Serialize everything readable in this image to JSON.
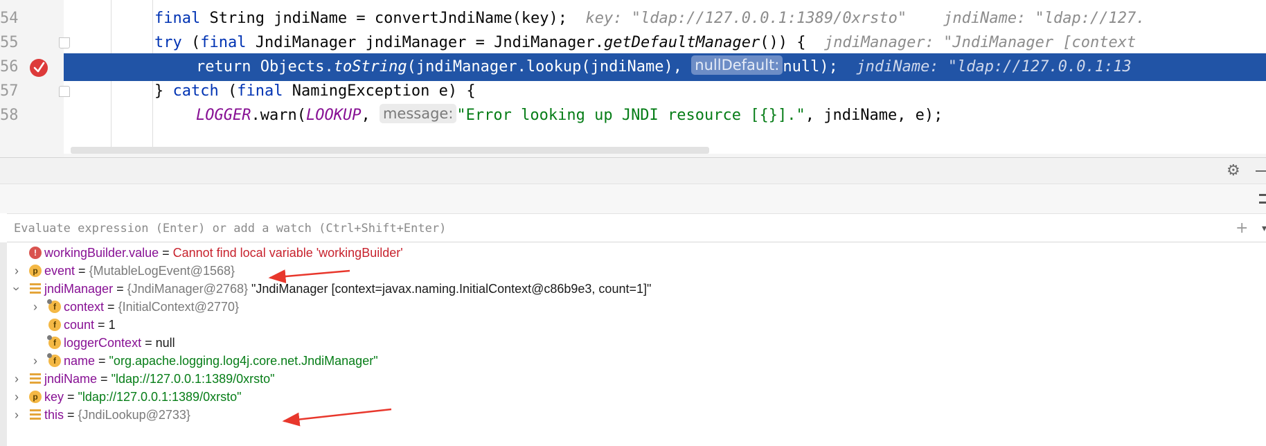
{
  "editor": {
    "lines": [
      {
        "number": "54",
        "code_a": "final",
        "code_b": " String jndiName = convertJndiName(key);",
        "inline_values": "  key: \"ldap://127.0.0.1:1389/0xrsto\"    jndiName: \"ldap://127."
      },
      {
        "number": "55",
        "code_a": "try",
        "code_b": " (",
        "code_c": "final",
        "code_d": " JndiManager jndiManager = JndiManager.",
        "code_e": "getDefaultManager",
        "code_f": "()) {",
        "inline_values": "  jndiManager: \"JndiManager [context"
      },
      {
        "number": "56",
        "code_a": "return",
        "code_b": " Objects.",
        "code_c": "toString",
        "code_d": "(jndiManager.lookup(jndiName), ",
        "hint": "nullDefault:",
        "code_e": "null);",
        "inline_values": "  jndiName: \"ldap://127.0.0.1:13"
      },
      {
        "number": "57",
        "code_a": "} ",
        "code_b": "catch",
        "code_c": " (",
        "code_d": "final",
        "code_e": " NamingException e) {"
      },
      {
        "number": "58",
        "code_a": "LOGGER",
        "code_b": ".warn(",
        "code_c": "LOOKUP",
        "code_d": ", ",
        "hint": "message:",
        "code_e": "\"Error looking up JNDI resource [{}].\"",
        "code_f": ", jndiName, e);"
      }
    ]
  },
  "panel": {
    "eval_placeholder": "Evaluate expression (Enter) or add a watch (Ctrl+Shift+Enter)",
    "eval_value": "",
    "icons": {
      "gear": "⚙",
      "add": "+",
      "dropdown": "▾"
    }
  },
  "variables": [
    {
      "icon": "!",
      "name": "workingBuilder.value",
      "eq": " = ",
      "value": "Cannot find local variable 'workingBuilder'",
      "value_kind": "error"
    },
    {
      "icon": "p",
      "name": "event",
      "eq": " = ",
      "value": "{MutableLogEvent@1568}",
      "value_kind": "type"
    },
    {
      "icon": "lines",
      "name": "jndiManager",
      "eq": " = ",
      "value": "{JndiManager@2768}",
      "value_kind": "type",
      "extra": " \"JndiManager [context=javax.naming.InitialContext@c86b9e3, count=1]\""
    },
    {
      "icon": "f",
      "name": "context",
      "eq": " = ",
      "value": "{InitialContext@2770}",
      "value_kind": "type"
    },
    {
      "icon": "f",
      "name": "count",
      "eq": " = ",
      "value": "1",
      "value_kind": "plain"
    },
    {
      "icon": "f",
      "name": "loggerContext",
      "eq": " = ",
      "value": "null",
      "value_kind": "plain"
    },
    {
      "icon": "f",
      "name": "name",
      "eq": " = ",
      "value": "\"org.apache.logging.log4j.core.net.JndiManager\"",
      "value_kind": "string"
    },
    {
      "icon": "lines",
      "name": "jndiName",
      "eq": " = ",
      "value": "\"ldap://127.0.0.1:1389/0xrsto\"",
      "value_kind": "string"
    },
    {
      "icon": "p",
      "name": "key",
      "eq": " = ",
      "value": "\"ldap://127.0.0.1:1389/0xrsto\"",
      "value_kind": "string"
    },
    {
      "icon": "lines",
      "name": "this",
      "eq": " = ",
      "value": "{JndiLookup@2733}",
      "value_kind": "type"
    }
  ],
  "colors": {
    "current_line": "#2154a6",
    "keyword": "#0033b3",
    "string": "#067d17",
    "field": "#871094",
    "error": "#c7222d",
    "annotation_arrow": "#e8372c"
  }
}
